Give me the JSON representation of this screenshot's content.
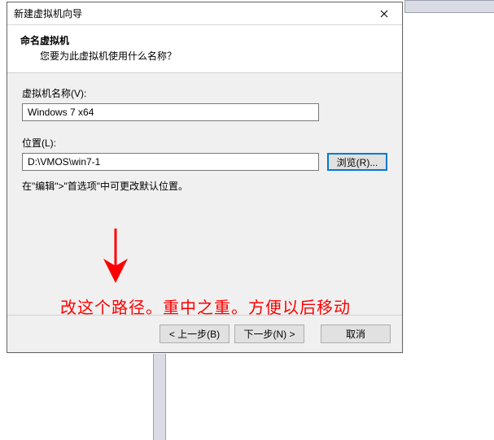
{
  "dialog": {
    "title": "新建虚拟机向导",
    "header_title": "命名虚拟机",
    "header_sub": "您要为此虚拟机使用什么名称？"
  },
  "vm_name": {
    "label": "虚拟机名称(V):",
    "value": "Windows 7 x64"
  },
  "location": {
    "label": "位置(L):",
    "value": "D:\\VMOS\\win7-1",
    "browse_label": "浏览(R)..."
  },
  "hint": "在\"编辑\">\"首选项\"中可更改默认位置。",
  "footer": {
    "back_label": "< 上一步(B)",
    "next_label": "下一步(N) >",
    "cancel_label": "取消"
  },
  "annotation": {
    "text": "改这个路径。重中之重。方便以后移动"
  }
}
